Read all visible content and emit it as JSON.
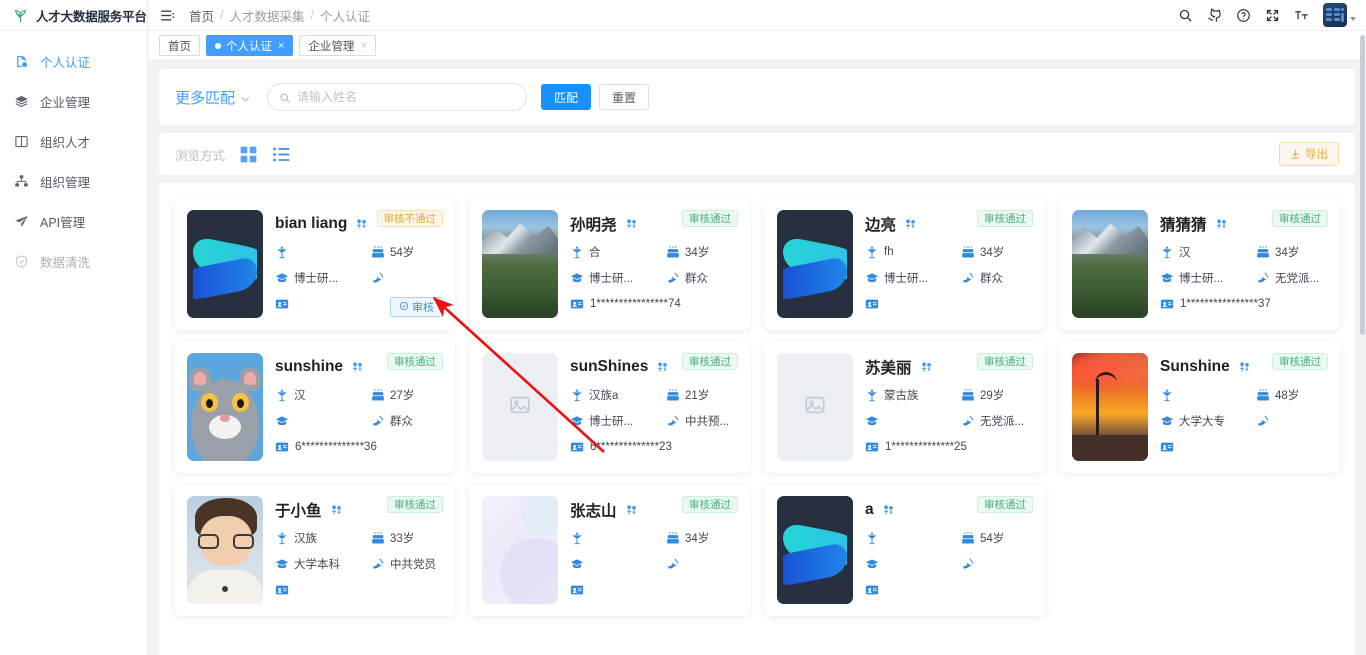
{
  "brand": {
    "title": "人才大数据服务平台",
    "logo_icon": "plant-leaf-icon"
  },
  "sidebar": {
    "items": [
      {
        "label": "个人认证",
        "icon": "file-badge-icon",
        "active": true
      },
      {
        "label": "企业管理",
        "icon": "layers-icon",
        "active": false
      },
      {
        "label": "组织人才",
        "icon": "book-open-icon",
        "active": false
      },
      {
        "label": "组织管理",
        "icon": "sitemap-icon",
        "active": false
      },
      {
        "label": "API管理",
        "icon": "send-icon",
        "active": false
      },
      {
        "label": "数据清洗",
        "icon": "shield-check-icon",
        "active": false,
        "dim": true
      }
    ]
  },
  "topbar": {
    "menu_icon": "hamburger-icon",
    "breadcrumbs": [
      "首页",
      "人才数据采集",
      "个人认证"
    ],
    "separator": "/",
    "actions": [
      {
        "name": "search-icon",
        "title": "搜索"
      },
      {
        "name": "github-icon",
        "title": "GitHub"
      },
      {
        "name": "help-circle-icon",
        "title": "帮助"
      },
      {
        "name": "fullscreen-icon",
        "title": "全屏"
      },
      {
        "name": "font-size-icon",
        "title": "字体大小"
      }
    ],
    "avatar_name": "user-avatar"
  },
  "tabs": [
    {
      "label": "首页",
      "active": false,
      "closable": false
    },
    {
      "label": "个人认证",
      "active": true,
      "closable": true,
      "close_label": "×"
    },
    {
      "label": "企业管理",
      "active": false,
      "closable": true,
      "close_label": "×"
    }
  ],
  "filter": {
    "more_match_label": "更多匹配",
    "chevron_icon": "chevron-down-icon",
    "search_placeholder": "请输入姓名",
    "search_value": "",
    "search_icon": "search-icon",
    "match_button": "匹配",
    "reset_button": "重置"
  },
  "viewbar": {
    "label": "浏览方式",
    "grid_icon": "grid-view-icon",
    "list_icon": "list-view-icon",
    "export_label": "导出",
    "export_icon": "download-icon",
    "export_color": "#e9a93c"
  },
  "colors": {
    "accent": "#409eff",
    "primary_button": "#1890ff",
    "badge_pass_text": "#4caf7d",
    "badge_pass_bg": "#eafaf0",
    "badge_fail_text": "#e7ab3e",
    "badge_fail_bg": "#fdf5e6",
    "annotation_arrow": "#ee1111"
  },
  "card_icons": {
    "gender": "gender-icon",
    "ethnicity": "ethnicity-icon",
    "age": "birthday-cake-icon",
    "education": "graduation-cap-icon",
    "politics": "hammer-sickle-icon",
    "id_card": "id-card-icon",
    "review": "check-circle-icon"
  },
  "cards": [
    {
      "name": "bian liang",
      "status": "审核不通过",
      "status_type": "fail",
      "ethnicity": "",
      "age": "54岁",
      "education": "博士研...",
      "politics": "",
      "id": "",
      "photo": "logo",
      "review_button": "审核"
    },
    {
      "name": "孙明尧",
      "status": "审核通过",
      "status_type": "pass",
      "ethnicity": "合",
      "age": "34岁",
      "education": "博士研...",
      "politics": "群众",
      "id": "1****************74",
      "photo": "nature",
      "review_button": ""
    },
    {
      "name": "边亮",
      "status": "审核通过",
      "status_type": "pass",
      "ethnicity": "fh",
      "age": "34岁",
      "education": "博士研...",
      "politics": "群众",
      "id": "",
      "photo": "logo",
      "review_button": ""
    },
    {
      "name": "猜猜猜",
      "status": "审核通过",
      "status_type": "pass",
      "ethnicity": "汉",
      "age": "34岁",
      "education": "博士研...",
      "politics": "无党派...",
      "id": "1****************37",
      "photo": "nature",
      "review_button": ""
    },
    {
      "name": "sunshine",
      "status": "审核通过",
      "status_type": "pass",
      "ethnicity": "汉",
      "age": "27岁",
      "education": "",
      "politics": "群众",
      "id": "6**************36",
      "photo": "cat",
      "review_button": ""
    },
    {
      "name": "sunShines",
      "status": "审核通过",
      "status_type": "pass",
      "ethnicity": "汉族a",
      "age": "21岁",
      "education": "博士研...",
      "politics": "中共预...",
      "id": "6**************23",
      "photo": "placeholder",
      "review_button": ""
    },
    {
      "name": "苏美丽",
      "status": "审核通过",
      "status_type": "pass",
      "ethnicity": "蒙古族",
      "age": "29岁",
      "education": "",
      "politics": "无党派...",
      "id": "1**************25",
      "photo": "placeholder",
      "review_button": ""
    },
    {
      "name": "Sunshine",
      "status": "审核通过",
      "status_type": "pass",
      "ethnicity": "",
      "age": "48岁",
      "education": "大学大专",
      "politics": "",
      "id": "",
      "photo": "sunset",
      "review_button": ""
    },
    {
      "name": "于小鱼",
      "status": "审核通过",
      "status_type": "pass",
      "ethnicity": "汉族",
      "age": "33岁",
      "education": "大学本科",
      "politics": "中共党员",
      "id": "",
      "photo": "boy",
      "review_button": ""
    },
    {
      "name": "张志山",
      "status": "审核通过",
      "status_type": "pass",
      "ethnicity": "",
      "age": "34岁",
      "education": "",
      "politics": "",
      "id": "",
      "photo": "blur",
      "review_button": ""
    },
    {
      "name": "a",
      "status": "审核通过",
      "status_type": "pass",
      "ethnicity": "",
      "age": "54岁",
      "education": "",
      "politics": "",
      "id": "",
      "photo": "logo",
      "review_button": ""
    }
  ]
}
